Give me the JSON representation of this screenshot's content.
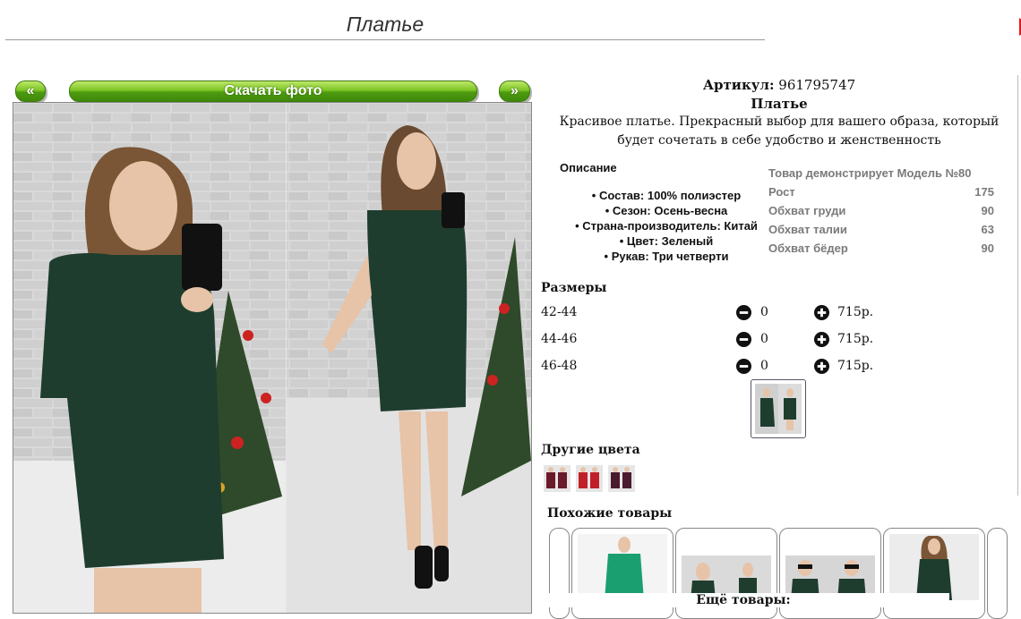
{
  "page_title": "Платье",
  "gallery": {
    "prev_label": "«",
    "download_label": "Скачать фото",
    "next_label": "»"
  },
  "product": {
    "article_label": "Артикул:",
    "article_value": "961795747",
    "name": "Платье",
    "description": "Красивое платье. Прекрасный выбор для вашего образа, который будет сочетать в себе удобство и женственность"
  },
  "specs": {
    "heading": "Описание",
    "items": [
      "Состав: 100% полиэстер",
      "Сезон: Осень-весна",
      "Страна-производитель: Китай",
      "Цвет: Зеленый",
      "Рукав: Три четверти"
    ]
  },
  "model": {
    "title": "Товар демонстрирует Модель №80",
    "rows": [
      {
        "label": "Рост",
        "value": "175"
      },
      {
        "label": "Обхват груди",
        "value": "90"
      },
      {
        "label": "Обхват талии",
        "value": "63"
      },
      {
        "label": "Обхват бёдер",
        "value": "90"
      }
    ]
  },
  "sizes": {
    "heading": "Размеры",
    "rows": [
      {
        "size": "42-44",
        "qty": "0",
        "price": "715р."
      },
      {
        "size": "44-46",
        "qty": "0",
        "price": "715р."
      },
      {
        "size": "46-48",
        "qty": "0",
        "price": "715р."
      }
    ]
  },
  "other_colors": {
    "heading": "Другие цвета"
  },
  "similar": {
    "heading": "Похожие товары"
  },
  "more_goods": "Ещё товары:",
  "colors": {
    "button_green": "#5aa81a",
    "dress_green": "#1f3d2e",
    "dress_red": "#c0202a",
    "dress_maroon": "#6a1a2a"
  }
}
